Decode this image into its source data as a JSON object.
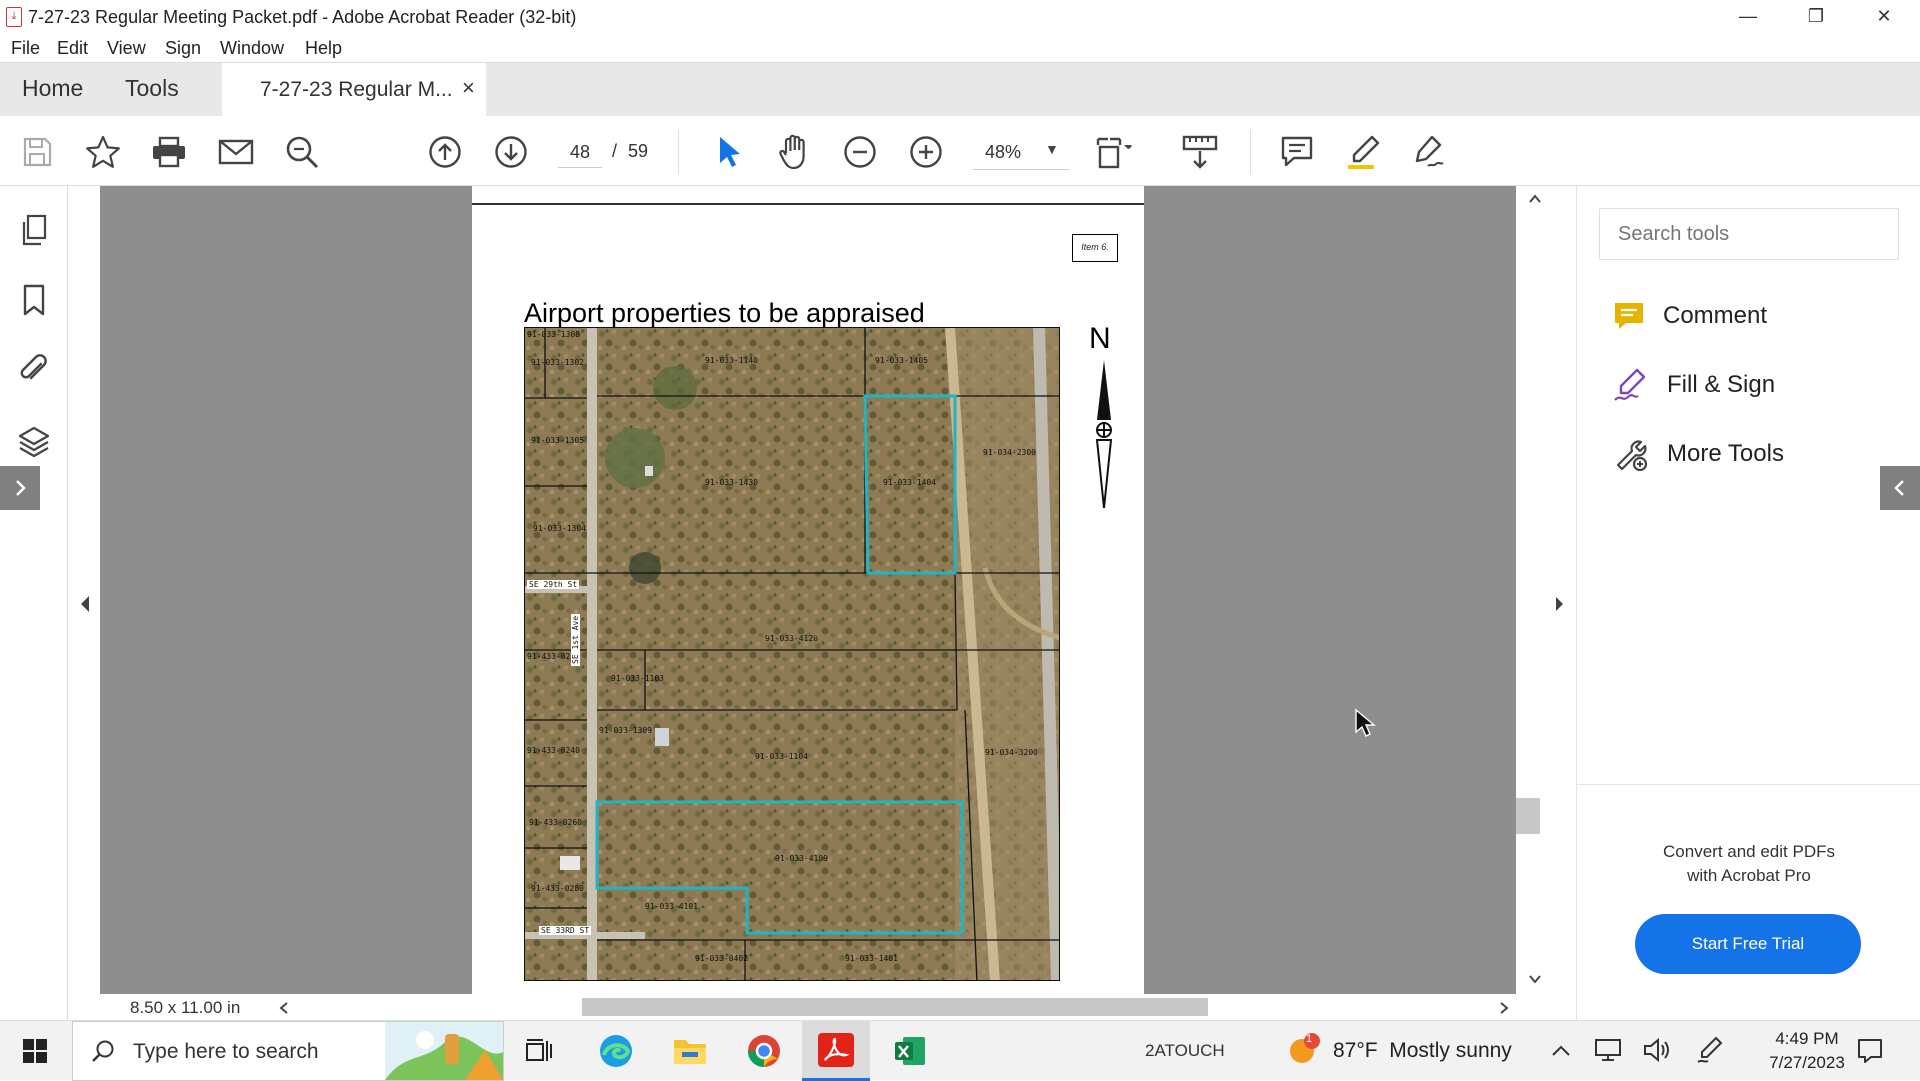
{
  "window": {
    "title": "7-27-23 Regular Meeting Packet.pdf - Adobe Acrobat Reader (32-bit)",
    "minimize": "—",
    "restore": "❐",
    "close": "✕"
  },
  "menu": [
    "File",
    "Edit",
    "View",
    "Sign",
    "Window",
    "Help"
  ],
  "tabs": {
    "home": "Home",
    "tools": "Tools",
    "document": "7-27-23 Regular M...",
    "close": "×"
  },
  "toolbar": {
    "current_page": "48",
    "page_separator": "/",
    "total_pages": "59",
    "zoom": "48%"
  },
  "document": {
    "item_label": "Item 6.",
    "heading": "Airport properties to be appraised",
    "north": "N",
    "parcels": [
      "91-033-1308",
      "91-033-1302",
      "91-033-1140",
      "91-033-1405",
      "91-033-1305",
      "91-034-2300",
      "91-033-1430",
      "91-033-1404",
      "91-033-1304",
      "91-033-4120",
      "91-433-0220",
      "91-033-1103",
      "91-033-1309",
      "91-433-0240",
      "91-033-1104",
      "91-034-3200",
      "91-433-0260",
      "91-033-4109",
      "91-433-0280",
      "91-033-4101",
      "91-033-0402",
      "91-033-1401"
    ],
    "streets": [
      "SE 29th St",
      "SE 1st Ave",
      "SE 33RD ST"
    ]
  },
  "status": {
    "page_size": "8.50 x 11.00 in"
  },
  "right_panel": {
    "search_placeholder": "Search tools",
    "tools": [
      "Comment",
      "Fill & Sign",
      "More Tools"
    ],
    "promo_line1": "Convert and edit PDFs",
    "promo_line2": "with Acrobat Pro",
    "cta": "Start Free Trial"
  },
  "taskbar": {
    "search_placeholder": "Type here to search",
    "tray_label": "2ATOUCH",
    "weather_badge": "1",
    "weather": "87°F  Mostly sunny",
    "time": "4:49 PM",
    "date": "7/27/2023"
  },
  "colors": {
    "accent_blue": "#1473e6",
    "comment_yellow": "#e6b300",
    "fillsign_purple": "#7a48b8",
    "parcel_outline": "#1fb5c4",
    "viewer_gray": "#8e8e8e"
  }
}
